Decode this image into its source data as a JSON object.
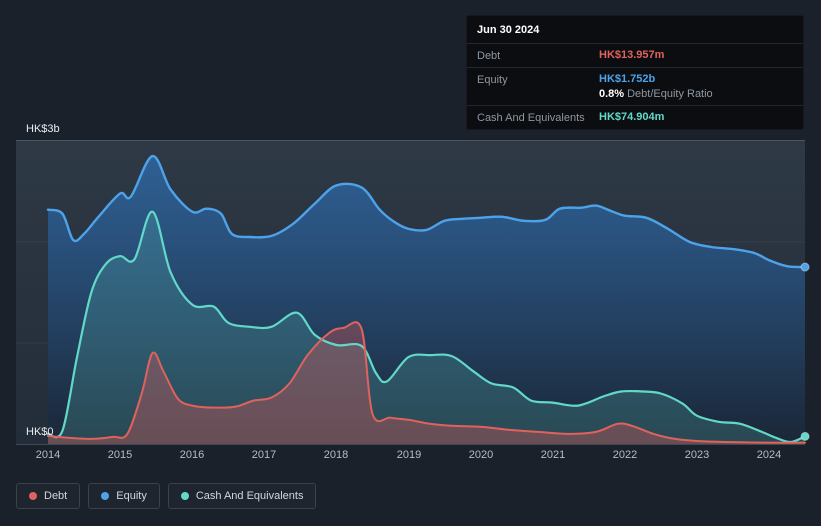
{
  "axis": {
    "y_max_label": "HK$3b",
    "y_min_label": "HK$0"
  },
  "tooltip": {
    "date": "Jun 30 2024",
    "debt_label": "Debt",
    "debt_value": "HK$13.957m",
    "equity_label": "Equity",
    "equity_value": "HK$1.752b",
    "ratio_value": "0.8%",
    "ratio_label": "Debt/Equity Ratio",
    "cash_label": "Cash And Equivalents",
    "cash_value": "HK$74.904m"
  },
  "legend": {
    "items": [
      {
        "label": "Debt"
      },
      {
        "label": "Equity"
      },
      {
        "label": "Cash And Equivalents"
      }
    ]
  },
  "colors": {
    "debt": "#e0625c",
    "equity": "#4da3ea",
    "cash": "#62d9c8",
    "equity_fill_top": "rgba(47,106,168,0.8)",
    "equity_fill_bottom": "rgba(26,38,54,0.95)",
    "cash_fill": "rgba(100,210,195,0.20)",
    "debt_fill": "rgba(224,90,90,0.35)"
  },
  "chart_data": {
    "type": "area",
    "title": "",
    "xlabel": "",
    "ylabel": "HK$",
    "y_unit": "HK$ billions",
    "ylim": [
      0,
      3
    ],
    "x_range": [
      2014,
      2024.5
    ],
    "x_ticks": [
      "2014",
      "2015",
      "2016",
      "2017",
      "2018",
      "2019",
      "2020",
      "2021",
      "2022",
      "2023",
      "2024"
    ],
    "y_tick_labels": [
      "HK$0",
      "HK$3b"
    ],
    "grid": "minimal",
    "legend_position": "bottom-left",
    "series": [
      {
        "name": "Equity",
        "points": [
          [
            2014,
            2.32
          ],
          [
            2014.2,
            2.28
          ],
          [
            2014.35,
            2.02
          ],
          [
            2014.5,
            2.08
          ],
          [
            2014.7,
            2.25
          ],
          [
            2015,
            2.48
          ],
          [
            2015.15,
            2.45
          ],
          [
            2015.45,
            2.85
          ],
          [
            2015.7,
            2.52
          ],
          [
            2016,
            2.3
          ],
          [
            2016.2,
            2.33
          ],
          [
            2016.4,
            2.28
          ],
          [
            2016.55,
            2.08
          ],
          [
            2016.8,
            2.05
          ],
          [
            2017.1,
            2.06
          ],
          [
            2017.4,
            2.18
          ],
          [
            2017.7,
            2.38
          ],
          [
            2018,
            2.56
          ],
          [
            2018.35,
            2.54
          ],
          [
            2018.6,
            2.32
          ],
          [
            2018.8,
            2.2
          ],
          [
            2019,
            2.13
          ],
          [
            2019.25,
            2.12
          ],
          [
            2019.5,
            2.21
          ],
          [
            2019.75,
            2.23
          ],
          [
            2020,
            2.24
          ],
          [
            2020.3,
            2.25
          ],
          [
            2020.6,
            2.21
          ],
          [
            2020.9,
            2.22
          ],
          [
            2021.1,
            2.33
          ],
          [
            2021.4,
            2.34
          ],
          [
            2021.6,
            2.36
          ],
          [
            2021.8,
            2.31
          ],
          [
            2022,
            2.26
          ],
          [
            2022.3,
            2.24
          ],
          [
            2022.6,
            2.13
          ],
          [
            2022.9,
            2.0
          ],
          [
            2023.2,
            1.95
          ],
          [
            2023.5,
            1.93
          ],
          [
            2023.8,
            1.89
          ],
          [
            2024,
            1.82
          ],
          [
            2024.25,
            1.76
          ],
          [
            2024.5,
            1.752
          ]
        ]
      },
      {
        "name": "Cash And Equivalents",
        "points": [
          [
            2014,
            0.1
          ],
          [
            2014.2,
            0.13
          ],
          [
            2014.4,
            0.85
          ],
          [
            2014.6,
            1.5
          ],
          [
            2014.8,
            1.78
          ],
          [
            2015,
            1.86
          ],
          [
            2015.2,
            1.83
          ],
          [
            2015.45,
            2.3
          ],
          [
            2015.7,
            1.7
          ],
          [
            2016,
            1.38
          ],
          [
            2016.3,
            1.36
          ],
          [
            2016.5,
            1.2
          ],
          [
            2016.8,
            1.16
          ],
          [
            2017.1,
            1.16
          ],
          [
            2017.45,
            1.3
          ],
          [
            2017.7,
            1.08
          ],
          [
            2018,
            0.98
          ],
          [
            2018.35,
            0.97
          ],
          [
            2018.55,
            0.7
          ],
          [
            2018.7,
            0.62
          ],
          [
            2019,
            0.86
          ],
          [
            2019.3,
            0.88
          ],
          [
            2019.6,
            0.87
          ],
          [
            2019.9,
            0.72
          ],
          [
            2020.15,
            0.6
          ],
          [
            2020.45,
            0.56
          ],
          [
            2020.7,
            0.43
          ],
          [
            2021,
            0.41
          ],
          [
            2021.35,
            0.38
          ],
          [
            2021.7,
            0.47
          ],
          [
            2021.95,
            0.52
          ],
          [
            2022.25,
            0.52
          ],
          [
            2022.5,
            0.5
          ],
          [
            2022.8,
            0.4
          ],
          [
            2023,
            0.28
          ],
          [
            2023.3,
            0.22
          ],
          [
            2023.6,
            0.2
          ],
          [
            2023.9,
            0.12
          ],
          [
            2024.1,
            0.06
          ],
          [
            2024.3,
            0.02
          ],
          [
            2024.5,
            0.075
          ]
        ]
      },
      {
        "name": "Debt",
        "points": [
          [
            2014,
            0.08
          ],
          [
            2014.3,
            0.06
          ],
          [
            2014.6,
            0.05
          ],
          [
            2014.9,
            0.07
          ],
          [
            2015.1,
            0.1
          ],
          [
            2015.3,
            0.5
          ],
          [
            2015.45,
            0.9
          ],
          [
            2015.6,
            0.72
          ],
          [
            2015.8,
            0.45
          ],
          [
            2016,
            0.38
          ],
          [
            2016.3,
            0.36
          ],
          [
            2016.6,
            0.37
          ],
          [
            2016.85,
            0.43
          ],
          [
            2017.1,
            0.46
          ],
          [
            2017.35,
            0.6
          ],
          [
            2017.6,
            0.88
          ],
          [
            2017.9,
            1.1
          ],
          [
            2018.1,
            1.15
          ],
          [
            2018.35,
            1.14
          ],
          [
            2018.5,
            0.3
          ],
          [
            2018.75,
            0.26
          ],
          [
            2019,
            0.24
          ],
          [
            2019.3,
            0.2
          ],
          [
            2019.6,
            0.18
          ],
          [
            2020,
            0.17
          ],
          [
            2020.4,
            0.14
          ],
          [
            2020.8,
            0.12
          ],
          [
            2021.2,
            0.1
          ],
          [
            2021.6,
            0.12
          ],
          [
            2021.9,
            0.2
          ],
          [
            2022.1,
            0.18
          ],
          [
            2022.4,
            0.1
          ],
          [
            2022.7,
            0.05
          ],
          [
            2023,
            0.03
          ],
          [
            2023.4,
            0.02
          ],
          [
            2023.8,
            0.015
          ],
          [
            2024.2,
            0.012
          ],
          [
            2024.5,
            0.014
          ]
        ]
      }
    ]
  }
}
